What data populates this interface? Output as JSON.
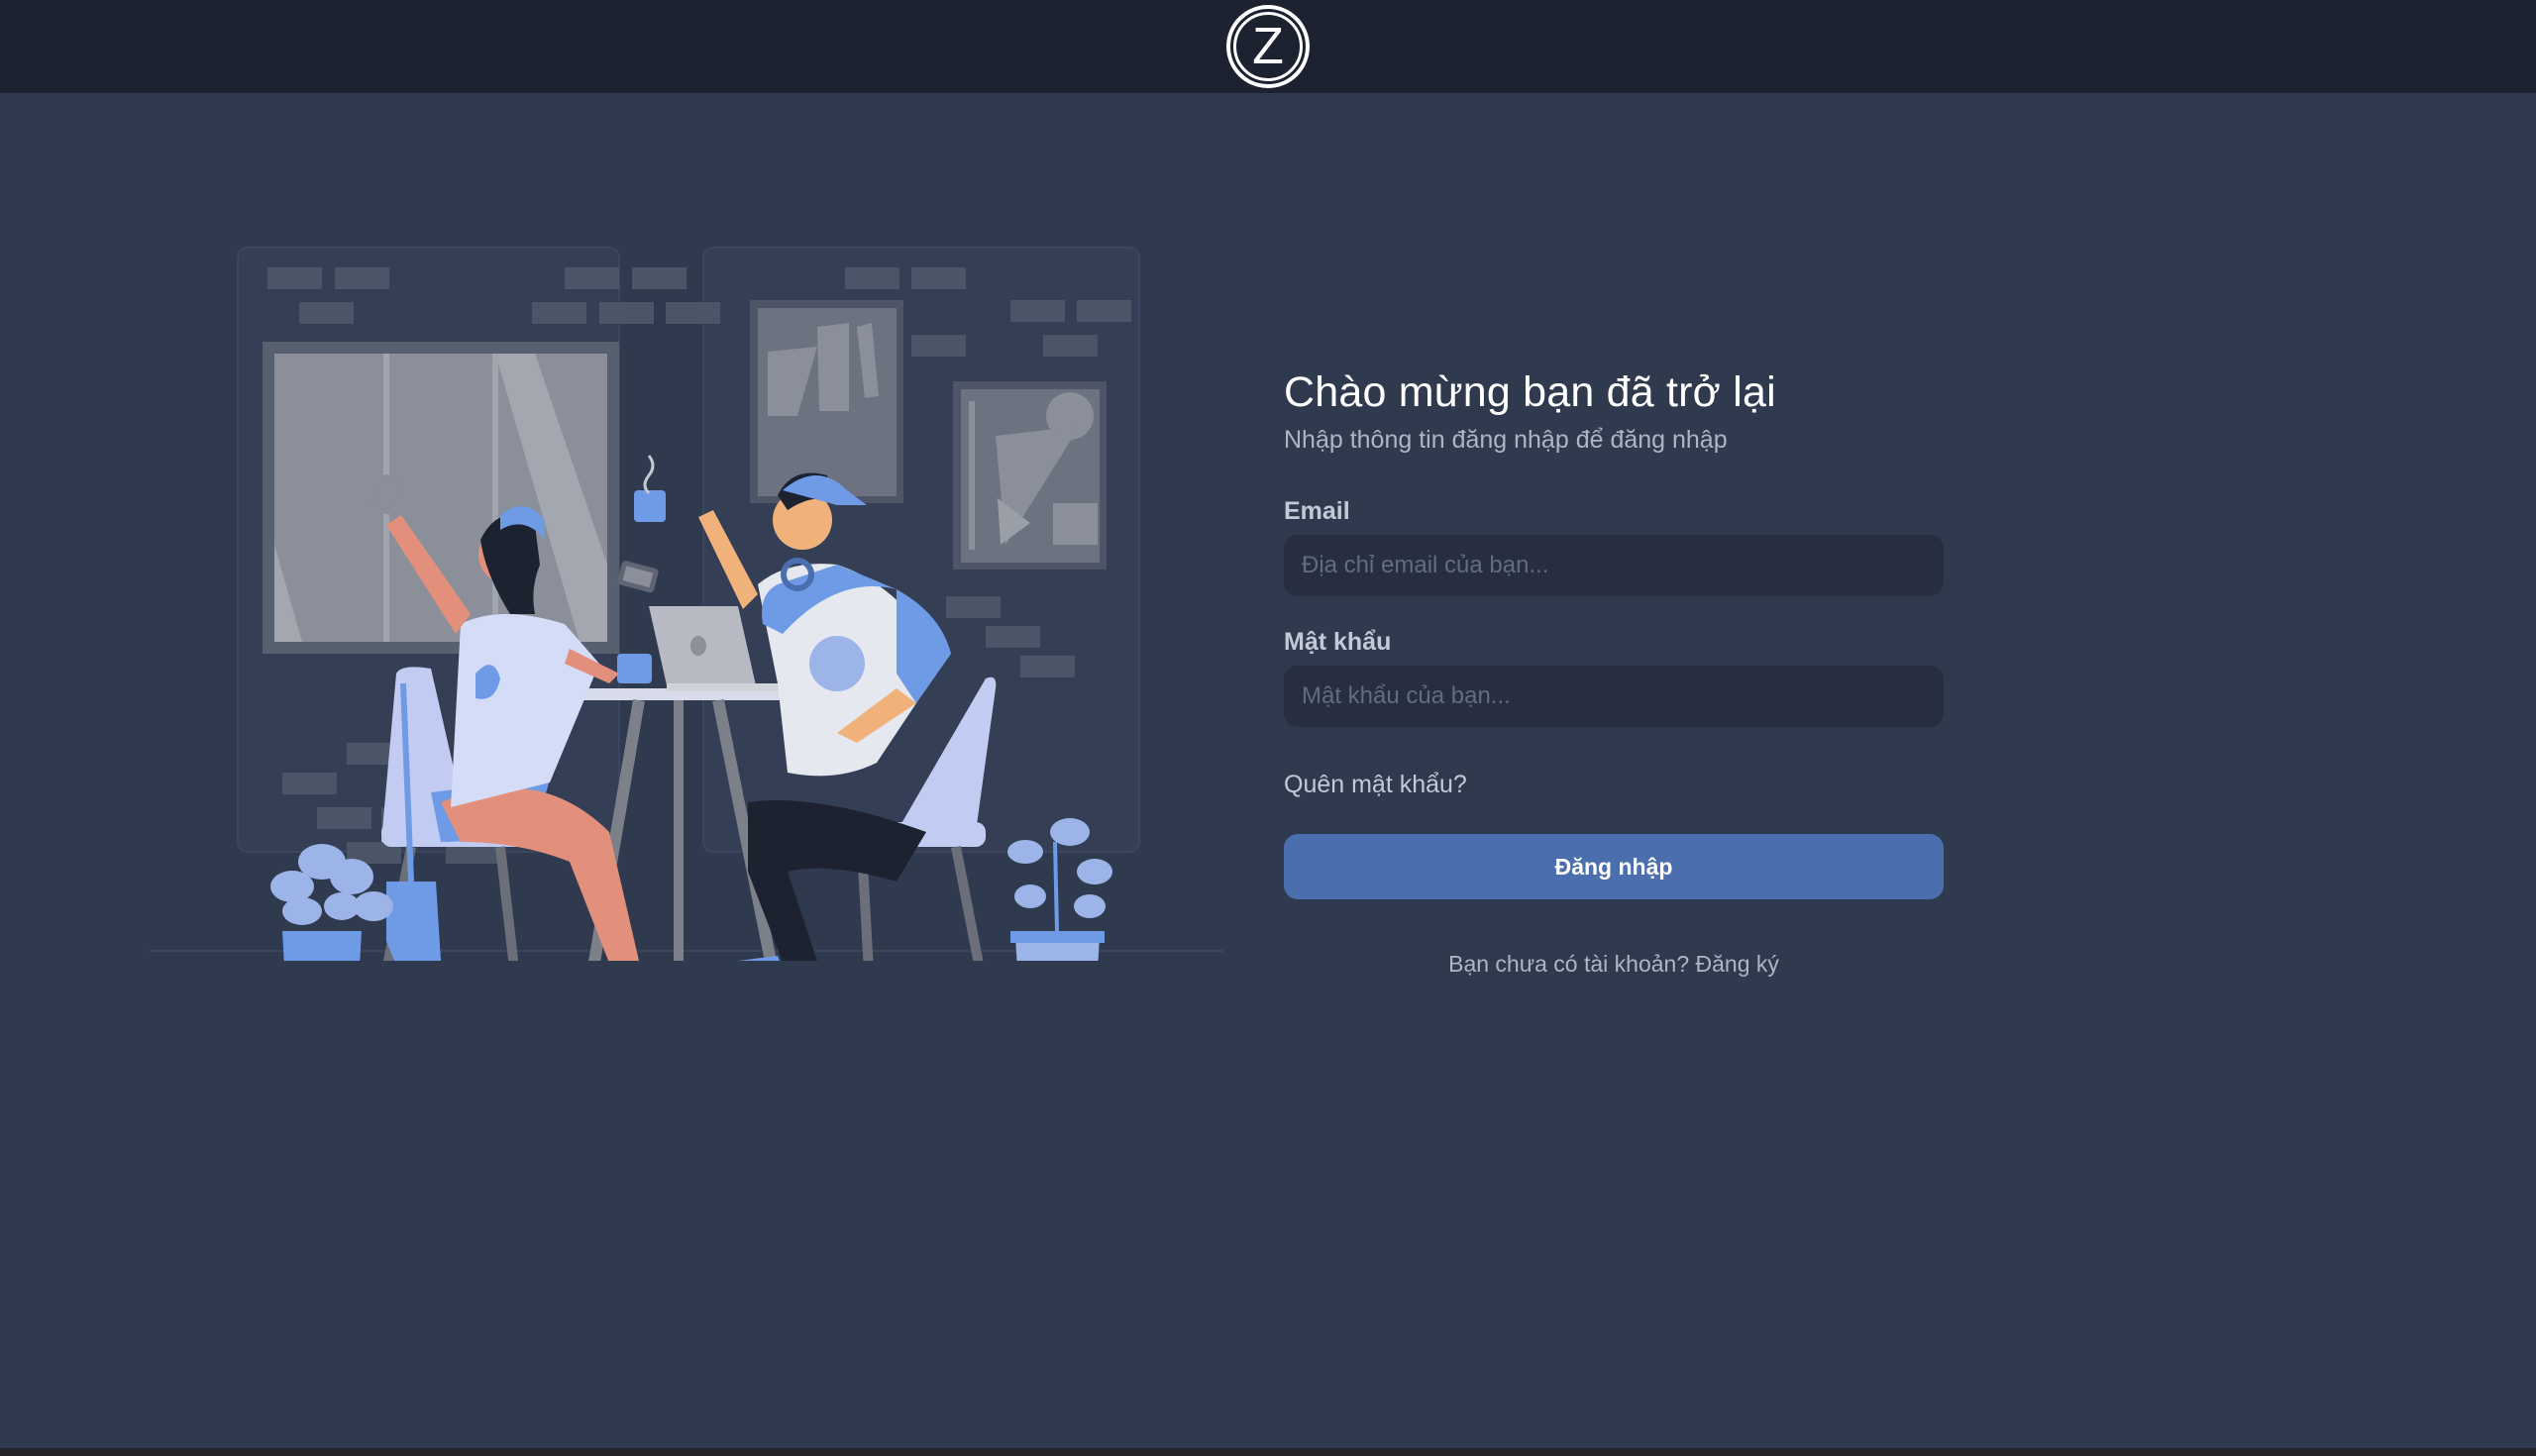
{
  "header": {
    "logo_letter": "Z"
  },
  "login": {
    "title": "Chào mừng bạn đã trở lại",
    "subtitle": "Nhập thông tin đăng nhập để đăng nhập",
    "email_label": "Email",
    "email_placeholder": "Địa chỉ email của bạn...",
    "email_value": "",
    "password_label": "Mật khẩu",
    "password_placeholder": "Mật khẩu của bạn...",
    "password_value": "",
    "forgot_link": "Quên mật khẩu?",
    "submit_label": "Đăng nhập",
    "register_prompt": "Bạn chưa có tài khoản?",
    "register_link": "Đăng ký"
  },
  "colors": {
    "topbar": "#1d2230",
    "background": "#2f3a4f",
    "input_bg": "#262e3f",
    "button": "#4b6fae",
    "accent_blue": "#6f9be6"
  },
  "illustration": {
    "name": "friends-at-cafe-illustration"
  }
}
